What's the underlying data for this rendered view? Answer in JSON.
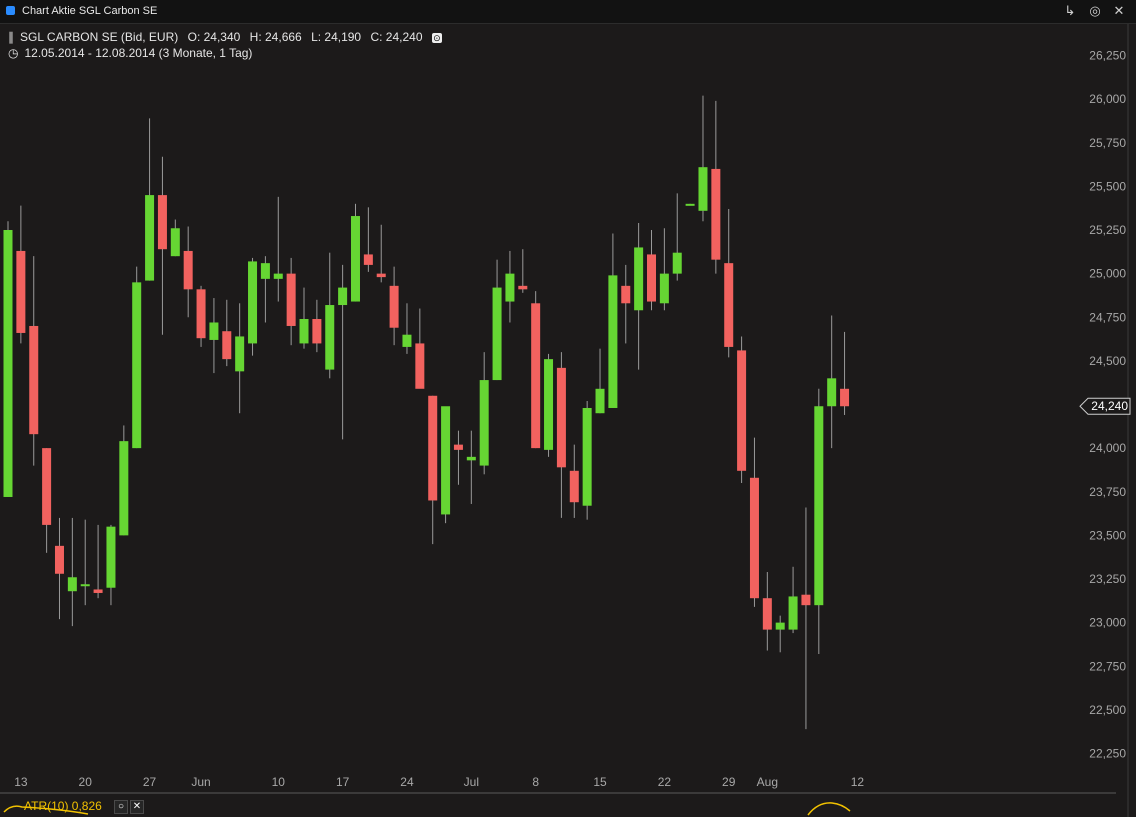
{
  "window": {
    "title": "Chart Aktie SGL Carbon SE"
  },
  "header": {
    "instrument": "SGL CARBON SE (Bid, EUR)",
    "open": "O: 24,340",
    "high": "H: 24,666",
    "low": "L: 24,190",
    "close": "C: 24,240",
    "period": "12.05.2014 - 12.08.2014 (3 Monate, 1 Tag)"
  },
  "price_tag": "24,240",
  "indicator": {
    "name": "ATR(10)",
    "value": "0,826",
    "close_label": "✕"
  },
  "colors": {
    "up": "#66d633",
    "down": "#f2625f",
    "indicator": "#f2c200",
    "background": "#1c1a1a"
  },
  "chart_data": {
    "type": "candlestick",
    "ylim": [
      22150,
      26300
    ],
    "y_ticks": [
      22250,
      22500,
      22750,
      23000,
      23250,
      23500,
      23750,
      24000,
      24250,
      24500,
      24750,
      25000,
      25250,
      25500,
      25750,
      26000,
      26250
    ],
    "y_tick_labels": [
      "22,250",
      "22,500",
      "22,750",
      "23,000",
      "23,250",
      "23,500",
      "23,750",
      "24,000",
      "24,250",
      "24,500",
      "24,750",
      "25,000",
      "25,250",
      "25,500",
      "25,750",
      "26,000",
      "26,250"
    ],
    "x_tick_labels": [
      {
        "label": "13",
        "date": "2014-05-13"
      },
      {
        "label": "20",
        "date": "2014-05-20"
      },
      {
        "label": "27",
        "date": "2014-05-27"
      },
      {
        "label": "Jun",
        "date": "2014-06-02"
      },
      {
        "label": "10",
        "date": "2014-06-10"
      },
      {
        "label": "17",
        "date": "2014-06-17"
      },
      {
        "label": "24",
        "date": "2014-06-24"
      },
      {
        "label": "Jul",
        "date": "2014-07-01"
      },
      {
        "label": "8",
        "date": "2014-07-08"
      },
      {
        "label": "15",
        "date": "2014-07-15"
      },
      {
        "label": "22",
        "date": "2014-07-22"
      },
      {
        "label": "29",
        "date": "2014-07-29"
      },
      {
        "label": "Aug",
        "date": "2014-08-01"
      },
      {
        "label": "12",
        "date": "2014-08-12"
      }
    ],
    "x_tick_index": [
      1,
      6,
      11,
      15,
      21,
      26,
      31,
      36,
      41,
      46,
      51,
      56,
      59,
      66
    ],
    "candles": [
      {
        "date": "2014-05-12",
        "o": 23720,
        "h": 25300,
        "l": 23720,
        "c": 25250
      },
      {
        "date": "2014-05-13",
        "o": 25130,
        "h": 25390,
        "l": 24600,
        "c": 24660
      },
      {
        "date": "2014-05-14",
        "o": 24700,
        "h": 25100,
        "l": 23900,
        "c": 24080
      },
      {
        "date": "2014-05-15",
        "o": 24000,
        "h": 24000,
        "l": 23400,
        "c": 23560
      },
      {
        "date": "2014-05-16",
        "o": 23440,
        "h": 23600,
        "l": 23020,
        "c": 23280
      },
      {
        "date": "2014-05-19",
        "o": 23180,
        "h": 23600,
        "l": 22980,
        "c": 23260
      },
      {
        "date": "2014-05-20",
        "o": 23210,
        "h": 23590,
        "l": 23100,
        "c": 23220
      },
      {
        "date": "2014-05-21",
        "o": 23190,
        "h": 23560,
        "l": 23140,
        "c": 23170
      },
      {
        "date": "2014-05-22",
        "o": 23200,
        "h": 23560,
        "l": 23100,
        "c": 23550
      },
      {
        "date": "2014-05-23",
        "o": 23500,
        "h": 24130,
        "l": 23500,
        "c": 24040
      },
      {
        "date": "2014-05-26",
        "o": 24000,
        "h": 25040,
        "l": 24000,
        "c": 24950
      },
      {
        "date": "2014-05-27",
        "o": 24960,
        "h": 25890,
        "l": 24960,
        "c": 25450
      },
      {
        "date": "2014-05-28",
        "o": 25450,
        "h": 25670,
        "l": 24650,
        "c": 25140
      },
      {
        "date": "2014-05-29",
        "o": 25100,
        "h": 25310,
        "l": 25100,
        "c": 25260
      },
      {
        "date": "2014-05-30",
        "o": 25130,
        "h": 25270,
        "l": 24750,
        "c": 24910
      },
      {
        "date": "2014-06-02",
        "o": 24910,
        "h": 24930,
        "l": 24580,
        "c": 24630
      },
      {
        "date": "2014-06-03",
        "o": 24620,
        "h": 24860,
        "l": 24430,
        "c": 24720
      },
      {
        "date": "2014-06-04",
        "o": 24670,
        "h": 24850,
        "l": 24470,
        "c": 24510
      },
      {
        "date": "2014-06-05",
        "o": 24440,
        "h": 24830,
        "l": 24200,
        "c": 24640
      },
      {
        "date": "2014-06-06",
        "o": 24600,
        "h": 25090,
        "l": 24530,
        "c": 25070
      },
      {
        "date": "2014-06-09",
        "o": 24970,
        "h": 25100,
        "l": 24720,
        "c": 25060
      },
      {
        "date": "2014-06-10",
        "o": 24970,
        "h": 25440,
        "l": 24840,
        "c": 25000
      },
      {
        "date": "2014-06-11",
        "o": 25000,
        "h": 25090,
        "l": 24590,
        "c": 24700
      },
      {
        "date": "2014-06-12",
        "o": 24600,
        "h": 24920,
        "l": 24570,
        "c": 24740
      },
      {
        "date": "2014-06-13",
        "o": 24740,
        "h": 24850,
        "l": 24550,
        "c": 24600
      },
      {
        "date": "2014-06-16",
        "o": 24450,
        "h": 25120,
        "l": 24400,
        "c": 24820
      },
      {
        "date": "2014-06-17",
        "o": 24820,
        "h": 25050,
        "l": 24050,
        "c": 24920
      },
      {
        "date": "2014-06-18",
        "o": 24840,
        "h": 25400,
        "l": 24840,
        "c": 25330
      },
      {
        "date": "2014-06-19",
        "o": 25110,
        "h": 25380,
        "l": 25010,
        "c": 25050
      },
      {
        "date": "2014-06-20",
        "o": 25000,
        "h": 25280,
        "l": 24950,
        "c": 24980
      },
      {
        "date": "2014-06-23",
        "o": 24930,
        "h": 25040,
        "l": 24590,
        "c": 24690
      },
      {
        "date": "2014-06-24",
        "o": 24580,
        "h": 24830,
        "l": 24540,
        "c": 24650
      },
      {
        "date": "2014-06-25",
        "o": 24600,
        "h": 24800,
        "l": 24350,
        "c": 24340
      },
      {
        "date": "2014-06-26",
        "o": 24300,
        "h": 24300,
        "l": 23450,
        "c": 23700
      },
      {
        "date": "2014-06-27",
        "o": 23620,
        "h": 24120,
        "l": 23570,
        "c": 24240
      },
      {
        "date": "2014-06-30",
        "o": 24020,
        "h": 24100,
        "l": 23790,
        "c": 23990
      },
      {
        "date": "2014-07-01",
        "o": 23930,
        "h": 24100,
        "l": 23680,
        "c": 23950
      },
      {
        "date": "2014-07-02",
        "o": 23900,
        "h": 24550,
        "l": 23850,
        "c": 24390
      },
      {
        "date": "2014-07-03",
        "o": 24390,
        "h": 25080,
        "l": 24390,
        "c": 24920
      },
      {
        "date": "2014-07-04",
        "o": 24840,
        "h": 25130,
        "l": 24720,
        "c": 25000
      },
      {
        "date": "2014-07-07",
        "o": 24930,
        "h": 25140,
        "l": 24890,
        "c": 24910
      },
      {
        "date": "2014-07-08",
        "o": 24830,
        "h": 24900,
        "l": 24000,
        "c": 24000
      },
      {
        "date": "2014-07-09",
        "o": 23990,
        "h": 24540,
        "l": 23950,
        "c": 24510
      },
      {
        "date": "2014-07-10",
        "o": 24460,
        "h": 24550,
        "l": 23600,
        "c": 23890
      },
      {
        "date": "2014-07-11",
        "o": 23870,
        "h": 24020,
        "l": 23600,
        "c": 23690
      },
      {
        "date": "2014-07-14",
        "o": 23670,
        "h": 24270,
        "l": 23590,
        "c": 24230
      },
      {
        "date": "2014-07-15",
        "o": 24200,
        "h": 24570,
        "l": 24200,
        "c": 24340
      },
      {
        "date": "2014-07-16",
        "o": 24230,
        "h": 25230,
        "l": 24230,
        "c": 24990
      },
      {
        "date": "2014-07-17",
        "o": 24930,
        "h": 25050,
        "l": 24600,
        "c": 24830
      },
      {
        "date": "2014-07-18",
        "o": 24790,
        "h": 25290,
        "l": 24450,
        "c": 25150
      },
      {
        "date": "2014-07-21",
        "o": 25110,
        "h": 25250,
        "l": 24790,
        "c": 24840
      },
      {
        "date": "2014-07-22",
        "o": 24830,
        "h": 25260,
        "l": 24790,
        "c": 25000
      },
      {
        "date": "2014-07-23",
        "o": 25000,
        "h": 25460,
        "l": 24960,
        "c": 25120
      },
      {
        "date": "2014-07-24",
        "o": 25400,
        "h": 25400,
        "l": 25390,
        "c": 25400
      },
      {
        "date": "2014-07-25",
        "o": 25360,
        "h": 26020,
        "l": 25300,
        "c": 25610
      },
      {
        "date": "2014-07-28",
        "o": 25600,
        "h": 25990,
        "l": 25000,
        "c": 25080
      },
      {
        "date": "2014-07-29",
        "o": 25060,
        "h": 25370,
        "l": 24520,
        "c": 24580
      },
      {
        "date": "2014-07-30",
        "o": 24560,
        "h": 24640,
        "l": 23800,
        "c": 23870
      },
      {
        "date": "2014-07-31",
        "o": 23830,
        "h": 24060,
        "l": 23090,
        "c": 23140
      },
      {
        "date": "2014-08-01",
        "o": 23140,
        "h": 23290,
        "l": 22840,
        "c": 22960
      },
      {
        "date": "2014-08-04",
        "o": 22960,
        "h": 23040,
        "l": 22830,
        "c": 23000
      },
      {
        "date": "2014-08-05",
        "o": 22960,
        "h": 23320,
        "l": 22940,
        "c": 23150
      },
      {
        "date": "2014-08-06",
        "o": 23160,
        "h": 23660,
        "l": 22390,
        "c": 23100
      },
      {
        "date": "2014-08-07",
        "o": 23100,
        "h": 24340,
        "l": 22820,
        "c": 24240
      },
      {
        "date": "2014-08-08",
        "o": 24240,
        "h": 24760,
        "l": 24000,
        "c": 24400
      },
      {
        "date": "2014-08-11",
        "o": 24340,
        "h": 24666,
        "l": 24190,
        "c": 24240
      }
    ]
  }
}
